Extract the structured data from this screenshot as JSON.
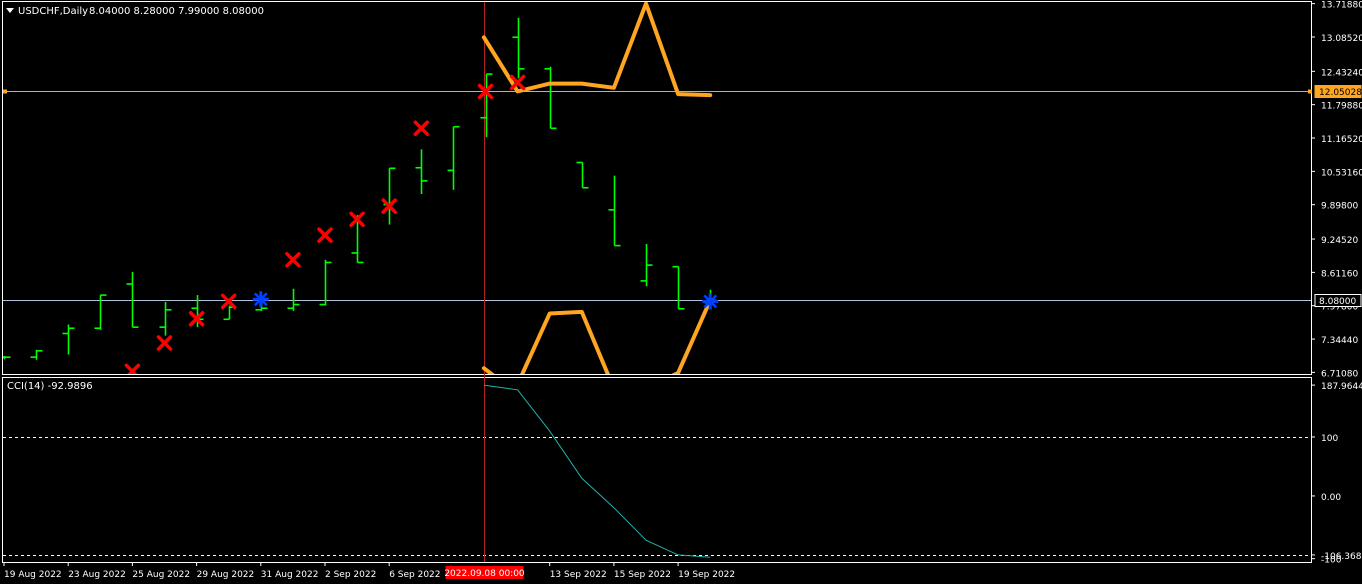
{
  "header": {
    "symbol_label": "USDCHF,Daily",
    "ohlc_values": "8.04000 8.28000 7.99000 8.08000",
    "collapse_icon": "triangle-down-icon"
  },
  "colors": {
    "background": "#000000",
    "frame": "#FFFFFF",
    "bar": "#00FF00",
    "orange_line": "#FFA51F",
    "marker_red": "#FF0000",
    "marker_blue": "#0040FF",
    "cci_line": "#20B2AA",
    "crosshair": "#B22222",
    "hline_level": "#FFA51F",
    "hline_bid": "#B0C4DE",
    "date_badge": "#FF0000"
  },
  "chart_data": [
    {
      "type": "ohlc",
      "panel": "main",
      "ylim": [
        6.68,
        13.75
      ],
      "price_ticks": [
        "13.71880",
        "13.08520",
        "12.43240",
        "11.79880",
        "11.16520",
        "10.53160",
        "9.89800",
        "9.24520",
        "8.61160",
        "7.97800",
        "7.34440",
        "6.71080"
      ],
      "price_tick_values": [
        13.7188,
        13.0852,
        12.4324,
        11.7988,
        11.1652,
        10.5316,
        9.898,
        9.2452,
        8.6116,
        7.978,
        7.3444,
        6.7108
      ],
      "level_line": {
        "value": 12.05028,
        "label": "12.05028"
      },
      "bid_line": {
        "value": 8.08,
        "label": "8.08000"
      },
      "bars": [
        {
          "o": 7.0,
          "h": 7.02,
          "l": 6.96,
          "c": 7.0
        },
        {
          "o": 7.0,
          "h": 7.14,
          "l": 6.95,
          "c": 7.12
        },
        {
          "o": 7.45,
          "h": 7.62,
          "l": 7.05,
          "c": 7.55
        },
        {
          "o": 7.55,
          "h": 8.18,
          "l": 7.52,
          "c": 8.18
        },
        {
          "o": 8.39,
          "h": 8.62,
          "l": 7.57,
          "c": 7.57
        },
        {
          "o": 7.57,
          "h": 8.05,
          "l": 7.41,
          "c": 7.9
        },
        {
          "o": 7.93,
          "h": 8.18,
          "l": 7.57,
          "c": 7.72
        },
        {
          "o": 7.72,
          "h": 7.98,
          "l": 7.72,
          "c": 7.95
        },
        {
          "o": 7.9,
          "h": 8.1,
          "l": 7.88,
          "c": 7.93
        },
        {
          "o": 7.93,
          "h": 8.3,
          "l": 7.88,
          "c": 8.0
        },
        {
          "o": 8.0,
          "h": 8.85,
          "l": 7.98,
          "c": 8.8
        },
        {
          "o": 8.98,
          "h": 9.7,
          "l": 8.8,
          "c": 8.8
        },
        {
          "o": 9.9,
          "h": 10.59,
          "l": 9.52,
          "c": 10.59
        },
        {
          "o": 10.6,
          "h": 10.95,
          "l": 10.1,
          "c": 10.35
        },
        {
          "o": 10.55,
          "h": 11.38,
          "l": 10.18,
          "c": 11.38
        },
        {
          "o": 11.55,
          "h": 12.38,
          "l": 11.18,
          "c": 12.38
        },
        {
          "o": 13.08,
          "h": 13.45,
          "l": 12.3,
          "c": 12.48
        },
        {
          "o": 12.48,
          "h": 12.52,
          "l": 11.35,
          "c": 11.35
        },
        {
          "o": 10.7,
          "h": 10.7,
          "l": 10.22,
          "c": 10.22
        },
        {
          "o": 9.8,
          "h": 10.45,
          "l": 9.12,
          "c": 9.12
        },
        {
          "o": 8.45,
          "h": 9.15,
          "l": 8.35,
          "c": 8.75
        },
        {
          "o": 8.72,
          "h": 8.72,
          "l": 7.92,
          "c": 7.92
        },
        {
          "o": 8.04,
          "h": 8.28,
          "l": 7.99,
          "c": 8.08
        }
      ],
      "x_labels": [
        "19 Aug 2022",
        "23 Aug 2022",
        "25 Aug 2022",
        "29 Aug 2022",
        "31 Aug 2022",
        "2 Sep 2022",
        "6 Sep 2022",
        "13 Sep 2022",
        "15 Sep 2022",
        "19 Sep 2022"
      ],
      "x_label_bar_index": [
        0,
        2,
        4,
        6,
        8,
        10,
        12,
        17,
        19,
        21
      ],
      "cursor_label": "2022.09.08 00:00",
      "cursor_bar_index": 14.95,
      "orange_upper": [
        {
          "i": 14.95,
          "v": 13.08
        },
        {
          "i": 16.0,
          "v": 12.05
        },
        {
          "i": 17.0,
          "v": 12.2
        },
        {
          "i": 18.0,
          "v": 12.2
        },
        {
          "i": 19.0,
          "v": 12.12
        },
        {
          "i": 20.0,
          "v": 13.72
        },
        {
          "i": 21.0,
          "v": 12.0
        },
        {
          "i": 22.0,
          "v": 11.98
        }
      ],
      "orange_lower": [
        {
          "i": 14.95,
          "v": 6.79
        },
        {
          "i": 15.9,
          "v": 6.35
        },
        {
          "i": 17.0,
          "v": 7.83
        },
        {
          "i": 18.0,
          "v": 7.86
        },
        {
          "i": 19.0,
          "v": 6.4
        },
        {
          "i": 20.0,
          "v": 6.4
        },
        {
          "i": 21.0,
          "v": 6.7
        },
        {
          "i": 22.0,
          "v": 8.08
        }
      ],
      "red_markers": [
        {
          "i": 4,
          "v": 6.73
        },
        {
          "i": 5,
          "v": 7.27
        },
        {
          "i": 6,
          "v": 7.73
        },
        {
          "i": 7,
          "v": 8.06
        },
        {
          "i": 9,
          "v": 8.85
        },
        {
          "i": 10,
          "v": 9.32
        },
        {
          "i": 11,
          "v": 9.62
        },
        {
          "i": 12,
          "v": 9.87
        },
        {
          "i": 13,
          "v": 11.35
        },
        {
          "i": 15,
          "v": 12.05
        },
        {
          "i": 16,
          "v": 12.22
        }
      ],
      "blue_markers": [
        {
          "i": 8,
          "v": 8.1
        },
        {
          "i": 22,
          "v": 8.06
        }
      ]
    },
    {
      "type": "line",
      "panel": "cci",
      "label": "CCI(14) -92.9896",
      "ylim": [
        -112,
        200
      ],
      "ticks": [
        "187.9644",
        "100",
        "0.00",
        "-106.3683",
        "-100"
      ],
      "tick_values": [
        187.9644,
        100,
        0,
        -100,
        -106.3683
      ],
      "dashed_levels": [
        100,
        -100
      ],
      "x": [
        14.95,
        16.0,
        17.0,
        18.0,
        19.0,
        20.0,
        21.0,
        22.0
      ],
      "values": [
        188,
        180,
        110,
        30,
        -20,
        -75,
        -100,
        -104
      ]
    }
  ]
}
